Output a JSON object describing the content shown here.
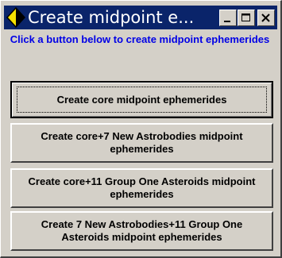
{
  "window": {
    "title": "Create midpoint e...",
    "icon": "yellow-diamond-icon"
  },
  "caption_buttons": {
    "minimize": "minimize-icon",
    "maximize": "maximize-icon",
    "close": "close-icon"
  },
  "instruction": "Click a button below to create midpoint ephemerides",
  "buttons": [
    {
      "label": "Create core midpoint ephemerides"
    },
    {
      "label": "Create core+7 New Astrobodies midpoint ephemerides"
    },
    {
      "label": "Create core+11 Group One Asteroids midpoint ephemerides"
    },
    {
      "label": "Create 7 New Astrobodies+11 Group One Asteroids midpoint ephemerides"
    }
  ],
  "colors": {
    "titlebar": "#0a246a",
    "instruction_text": "#0000e6",
    "face": "#d4d0c8",
    "icon_yellow": "#f5e100"
  }
}
